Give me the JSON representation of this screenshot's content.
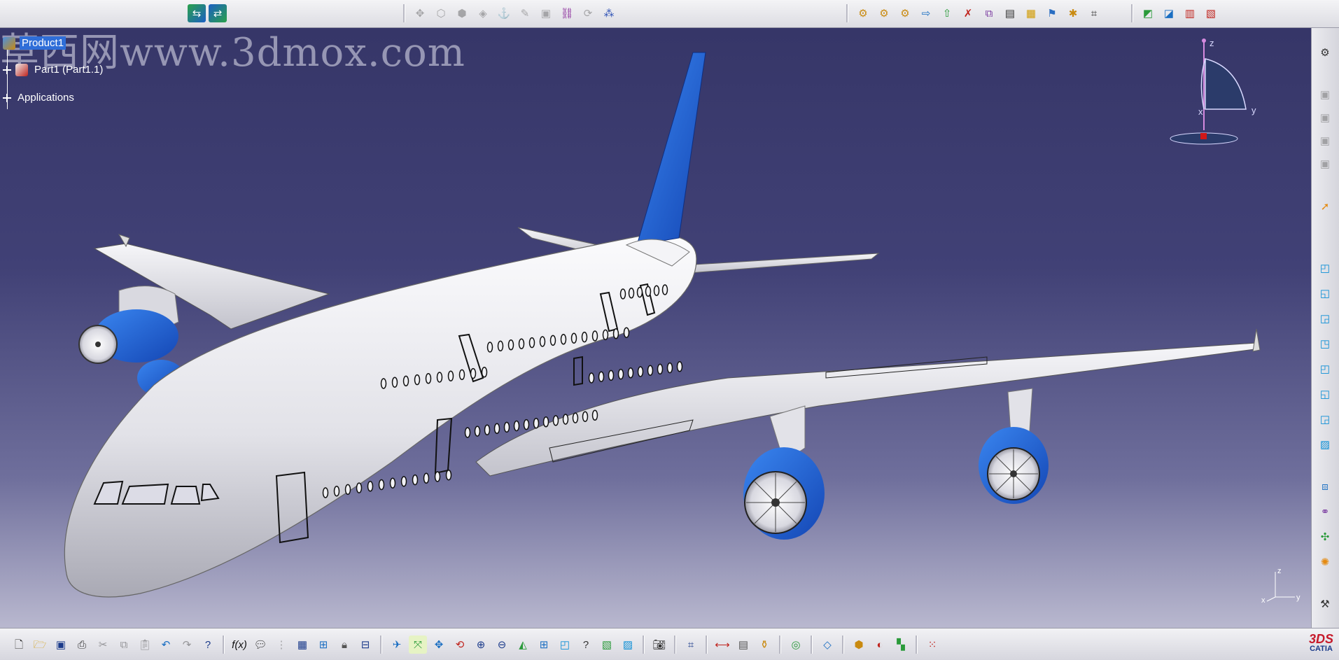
{
  "watermark": "草西网www.3dmox.com",
  "tree": {
    "root": "Product1",
    "child": "Part1 (Part1.1)",
    "applications": "Applications"
  },
  "compass": {
    "z": "z",
    "x": "x",
    "y": "y"
  },
  "axis_triad": {
    "z": "z",
    "x": "x",
    "y": "y"
  },
  "logo": {
    "mark": "3DS",
    "name": "CATIA"
  },
  "top_toolbar": {
    "group_a": [
      "swap-view-icon",
      "swap-view-alt-icon"
    ],
    "group_b": [
      "manipulation-icon",
      "snap-icon",
      "smart-move-icon",
      "explode-icon",
      "stop-manipulate-icon",
      "pen-icon",
      "analysis-icon",
      "chain-icon",
      "refresh-icon",
      "multi-instantiate-icon"
    ],
    "group_c": [
      "gear-generate-icon",
      "gear-numbering-icon",
      "gear-catalog-icon",
      "save-management-icon",
      "publish-icon",
      "product-init-icon",
      "scene-icon",
      "bom-icon",
      "text-icon",
      "flag-icon",
      "annotation-icon",
      "constraint-icon"
    ],
    "group_d": [
      "cube-view-icon",
      "cube-split-icon",
      "doc-red-icon",
      "doc-red-alt-icon"
    ]
  },
  "right_toolbar": [
    "gear-process-icon",
    "app-a-icon",
    "app-b-icon",
    "app-c-icon",
    "app-d-icon",
    "select-arrow-icon",
    "iso-view-icon",
    "front-view-icon",
    "back-view-icon",
    "left-view-icon",
    "right-view-icon",
    "top-view-icon",
    "bottom-view-icon",
    "named-view-icon",
    "render-icon",
    "bike-icon",
    "move-icon",
    "explode-orange-icon",
    "tools-icon"
  ],
  "bottom_toolbar": [
    "new-icon",
    "open-icon",
    "save-icon",
    "print-icon",
    "cut-icon",
    "copy-icon",
    "paste-icon",
    "undo-icon",
    "redo-icon",
    "whats-this-icon",
    "formula-icon",
    "comment-icon",
    "knowledge-icon",
    "table-icon",
    "tree-icon",
    "lock-icon",
    "structure-icon",
    "fly-mode-icon",
    "fit-all-icon",
    "pan-icon",
    "rotate-icon",
    "zoom-in-icon",
    "zoom-out-icon",
    "normal-view-icon",
    "multi-view-icon",
    "iso-cube-icon",
    "hide-show-icon",
    "swap-visible-icon",
    "render-style-icon",
    "capture-icon",
    "grid-icon",
    "measure-icon",
    "clash-icon",
    "material-icon",
    "sketch-icon",
    "layer-icon",
    "paint-icon",
    "palette-icon",
    "apply-material-icon",
    "constraint-grid-icon"
  ],
  "colors": {
    "fuselage": "#e6e6ea",
    "engine_blue": "#1f5fd6",
    "tail_blue": "#2a6bde",
    "tree_selected": "#2f6ed8"
  }
}
